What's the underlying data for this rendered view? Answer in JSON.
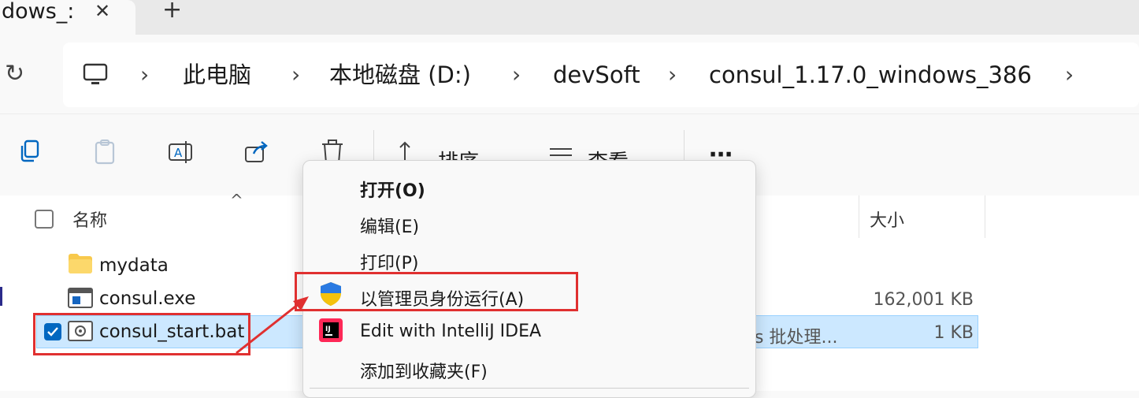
{
  "tab": {
    "title": "dows_:",
    "close": "✕",
    "new": "+"
  },
  "address": {
    "refresh": "↻",
    "crumbs": [
      "此电脑",
      "本地磁盘 (D:)",
      "devSoft",
      "consul_1.17.0_windows_386"
    ],
    "separator": "›"
  },
  "toolbar": {
    "sort_label": "排序",
    "view_label": "查看",
    "more_label": "⋯"
  },
  "list": {
    "header_name": "名称",
    "header_size": "大小",
    "sort_caret": "^",
    "rows": [
      {
        "name": "mydata",
        "icon": "folder-icon",
        "type": "",
        "size": ""
      },
      {
        "name": "consul.exe",
        "icon": "exe-icon",
        "type": "",
        "size": "162,001 KB"
      },
      {
        "name": "consul_start.bat",
        "icon": "bat-icon",
        "type": "s 批处理...",
        "size": "1 KB",
        "selected": true
      }
    ]
  },
  "context_menu": {
    "items": [
      {
        "label": "打开(O)",
        "bold": true
      },
      {
        "label": "编辑(E)"
      },
      {
        "label": "打印(P)"
      },
      {
        "label": "以管理员身份运行(A)",
        "icon": "uac-shield-icon"
      },
      {
        "label": "Edit with IntelliJ IDEA",
        "icon": "intellij-icon"
      },
      {
        "label": "添加到收藏夹(F)"
      }
    ]
  },
  "colors": {
    "accent": "#0067c0",
    "annotation": "#e03030",
    "selection": "#cce8ff"
  }
}
